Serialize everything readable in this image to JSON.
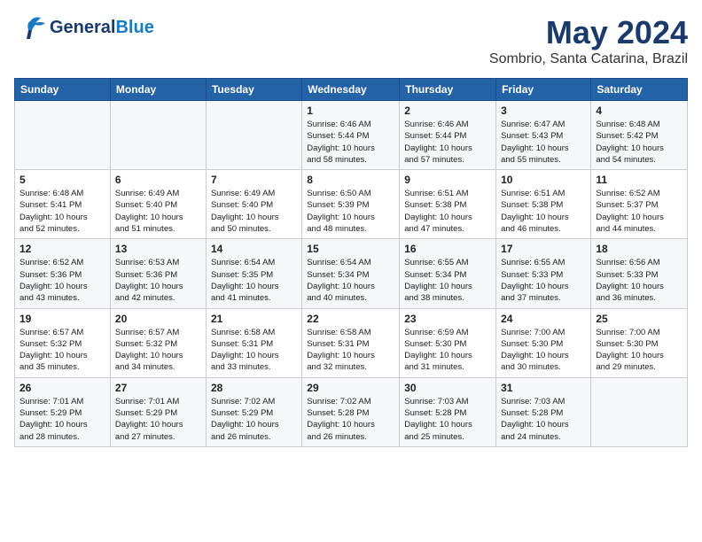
{
  "header": {
    "logo_line1": "General",
    "logo_line2": "Blue",
    "main_title": "May 2024",
    "subtitle": "Sombrio, Santa Catarina, Brazil"
  },
  "weekdays": [
    "Sunday",
    "Monday",
    "Tuesday",
    "Wednesday",
    "Thursday",
    "Friday",
    "Saturday"
  ],
  "weeks": [
    [
      {
        "day": "",
        "info": ""
      },
      {
        "day": "",
        "info": ""
      },
      {
        "day": "",
        "info": ""
      },
      {
        "day": "1",
        "info": "Sunrise: 6:46 AM\nSunset: 5:44 PM\nDaylight: 10 hours\nand 58 minutes."
      },
      {
        "day": "2",
        "info": "Sunrise: 6:46 AM\nSunset: 5:44 PM\nDaylight: 10 hours\nand 57 minutes."
      },
      {
        "day": "3",
        "info": "Sunrise: 6:47 AM\nSunset: 5:43 PM\nDaylight: 10 hours\nand 55 minutes."
      },
      {
        "day": "4",
        "info": "Sunrise: 6:48 AM\nSunset: 5:42 PM\nDaylight: 10 hours\nand 54 minutes."
      }
    ],
    [
      {
        "day": "5",
        "info": "Sunrise: 6:48 AM\nSunset: 5:41 PM\nDaylight: 10 hours\nand 52 minutes."
      },
      {
        "day": "6",
        "info": "Sunrise: 6:49 AM\nSunset: 5:40 PM\nDaylight: 10 hours\nand 51 minutes."
      },
      {
        "day": "7",
        "info": "Sunrise: 6:49 AM\nSunset: 5:40 PM\nDaylight: 10 hours\nand 50 minutes."
      },
      {
        "day": "8",
        "info": "Sunrise: 6:50 AM\nSunset: 5:39 PM\nDaylight: 10 hours\nand 48 minutes."
      },
      {
        "day": "9",
        "info": "Sunrise: 6:51 AM\nSunset: 5:38 PM\nDaylight: 10 hours\nand 47 minutes."
      },
      {
        "day": "10",
        "info": "Sunrise: 6:51 AM\nSunset: 5:38 PM\nDaylight: 10 hours\nand 46 minutes."
      },
      {
        "day": "11",
        "info": "Sunrise: 6:52 AM\nSunset: 5:37 PM\nDaylight: 10 hours\nand 44 minutes."
      }
    ],
    [
      {
        "day": "12",
        "info": "Sunrise: 6:52 AM\nSunset: 5:36 PM\nDaylight: 10 hours\nand 43 minutes."
      },
      {
        "day": "13",
        "info": "Sunrise: 6:53 AM\nSunset: 5:36 PM\nDaylight: 10 hours\nand 42 minutes."
      },
      {
        "day": "14",
        "info": "Sunrise: 6:54 AM\nSunset: 5:35 PM\nDaylight: 10 hours\nand 41 minutes."
      },
      {
        "day": "15",
        "info": "Sunrise: 6:54 AM\nSunset: 5:34 PM\nDaylight: 10 hours\nand 40 minutes."
      },
      {
        "day": "16",
        "info": "Sunrise: 6:55 AM\nSunset: 5:34 PM\nDaylight: 10 hours\nand 38 minutes."
      },
      {
        "day": "17",
        "info": "Sunrise: 6:55 AM\nSunset: 5:33 PM\nDaylight: 10 hours\nand 37 minutes."
      },
      {
        "day": "18",
        "info": "Sunrise: 6:56 AM\nSunset: 5:33 PM\nDaylight: 10 hours\nand 36 minutes."
      }
    ],
    [
      {
        "day": "19",
        "info": "Sunrise: 6:57 AM\nSunset: 5:32 PM\nDaylight: 10 hours\nand 35 minutes."
      },
      {
        "day": "20",
        "info": "Sunrise: 6:57 AM\nSunset: 5:32 PM\nDaylight: 10 hours\nand 34 minutes."
      },
      {
        "day": "21",
        "info": "Sunrise: 6:58 AM\nSunset: 5:31 PM\nDaylight: 10 hours\nand 33 minutes."
      },
      {
        "day": "22",
        "info": "Sunrise: 6:58 AM\nSunset: 5:31 PM\nDaylight: 10 hours\nand 32 minutes."
      },
      {
        "day": "23",
        "info": "Sunrise: 6:59 AM\nSunset: 5:30 PM\nDaylight: 10 hours\nand 31 minutes."
      },
      {
        "day": "24",
        "info": "Sunrise: 7:00 AM\nSunset: 5:30 PM\nDaylight: 10 hours\nand 30 minutes."
      },
      {
        "day": "25",
        "info": "Sunrise: 7:00 AM\nSunset: 5:30 PM\nDaylight: 10 hours\nand 29 minutes."
      }
    ],
    [
      {
        "day": "26",
        "info": "Sunrise: 7:01 AM\nSunset: 5:29 PM\nDaylight: 10 hours\nand 28 minutes."
      },
      {
        "day": "27",
        "info": "Sunrise: 7:01 AM\nSunset: 5:29 PM\nDaylight: 10 hours\nand 27 minutes."
      },
      {
        "day": "28",
        "info": "Sunrise: 7:02 AM\nSunset: 5:29 PM\nDaylight: 10 hours\nand 26 minutes."
      },
      {
        "day": "29",
        "info": "Sunrise: 7:02 AM\nSunset: 5:28 PM\nDaylight: 10 hours\nand 26 minutes."
      },
      {
        "day": "30",
        "info": "Sunrise: 7:03 AM\nSunset: 5:28 PM\nDaylight: 10 hours\nand 25 minutes."
      },
      {
        "day": "31",
        "info": "Sunrise: 7:03 AM\nSunset: 5:28 PM\nDaylight: 10 hours\nand 24 minutes."
      },
      {
        "day": "",
        "info": ""
      }
    ]
  ]
}
